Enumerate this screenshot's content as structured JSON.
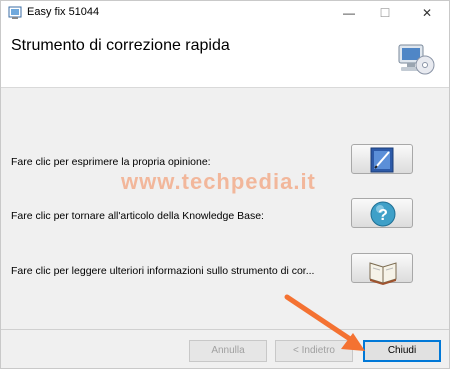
{
  "window": {
    "title": "Easy fix 51044",
    "controls": {
      "minimize": "—",
      "maximize": "☐",
      "close": "✕"
    }
  },
  "header": {
    "title": "Strumento di correzione rapida",
    "icon": "computer-cd-icon"
  },
  "rows": [
    {
      "label": "Fare clic per esprimere la propria opinione:",
      "icon": "feedback-pencil-icon"
    },
    {
      "label": "Fare clic per tornare all'articolo della Knowledge Base:",
      "icon": "help-question-icon"
    },
    {
      "label": "Fare clic per leggere ulteriori informazioni sullo strumento di cor...",
      "icon": "open-book-icon"
    }
  ],
  "watermark": "www.techpedia.it",
  "footer": {
    "cancel_label": "Annulla",
    "back_label": "< Indietro",
    "close_label": "Chiudi"
  },
  "colors": {
    "accent": "#0078d7",
    "watermark": "#f47232",
    "arrow": "#f47232"
  }
}
